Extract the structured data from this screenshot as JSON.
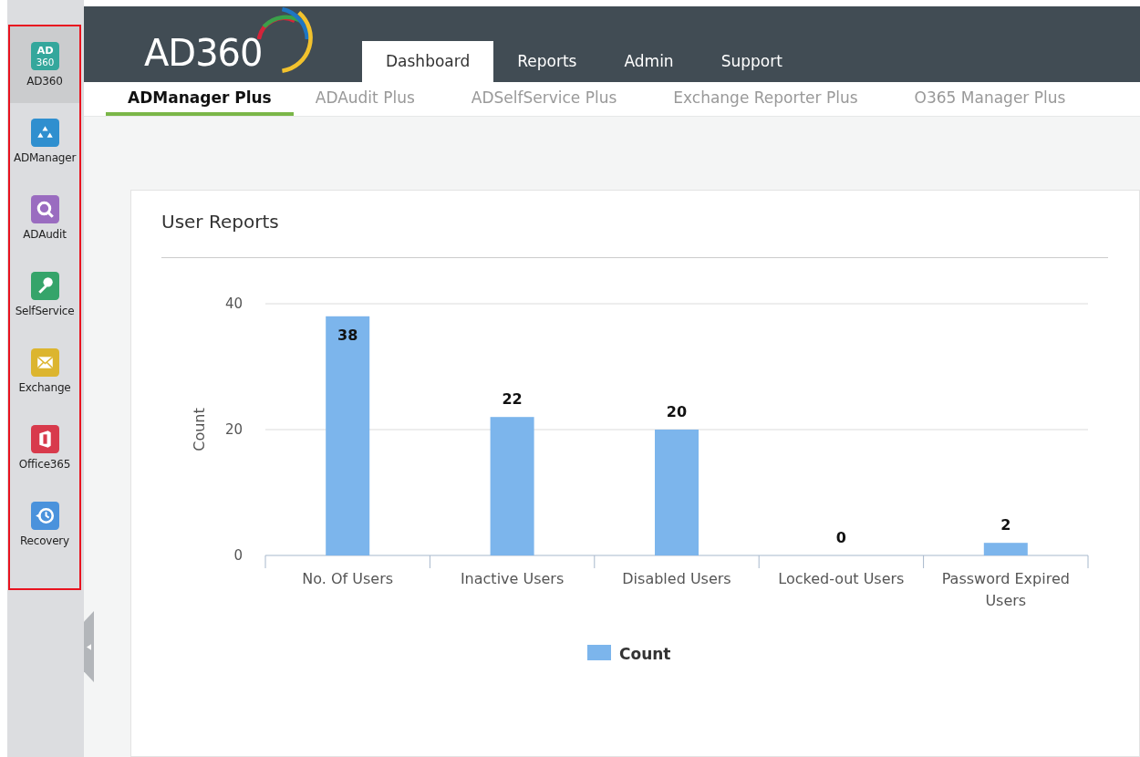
{
  "sidebar": {
    "items": [
      {
        "label": "AD360",
        "selected": true,
        "icon_text": [
          "AD",
          "360"
        ]
      },
      {
        "label": "ADManager",
        "selected": false
      },
      {
        "label": "ADAudit",
        "selected": false
      },
      {
        "label": "SelfService",
        "selected": false
      },
      {
        "label": "Exchange",
        "selected": false
      },
      {
        "label": "Office365",
        "selected": false
      },
      {
        "label": "Recovery",
        "selected": false
      }
    ]
  },
  "header": {
    "logo": "AD360",
    "tabs": [
      {
        "label": "Dashboard",
        "selected": true
      },
      {
        "label": "Reports",
        "selected": false
      },
      {
        "label": "Admin",
        "selected": false
      },
      {
        "label": "Support",
        "selected": false
      }
    ]
  },
  "product_tabs": [
    {
      "label": "ADManager Plus",
      "selected": true
    },
    {
      "label": "ADAudit Plus",
      "selected": false
    },
    {
      "label": "ADSelfService Plus",
      "selected": false
    },
    {
      "label": "Exchange Reporter Plus",
      "selected": false
    },
    {
      "label": "O365 Manager Plus",
      "selected": false
    }
  ],
  "card": {
    "title": "User Reports",
    "chart_data": {
      "type": "bar",
      "ylabel": "Count",
      "categories": [
        "No. Of Users",
        "Inactive Users",
        "Disabled Users",
        "Locked-out Users",
        "Password Expired Users"
      ],
      "series": [
        {
          "name": "Count",
          "color": "#7cb5ec",
          "values": [
            38,
            22,
            20,
            0,
            2
          ]
        }
      ],
      "ylim": [
        0,
        40
      ],
      "yticks": [
        0,
        20,
        40
      ],
      "data_labels": true
    }
  }
}
